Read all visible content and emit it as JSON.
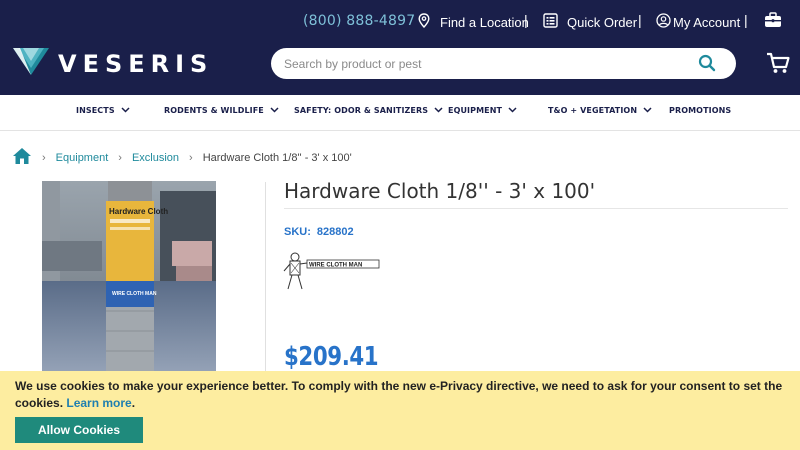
{
  "header": {
    "phone": "(800) 888-4897",
    "find_location": "Find a Location",
    "quick_order": "Quick Order",
    "my_account": "My Account",
    "logo_text": "VESERIS",
    "search_placeholder": "Search by product or pest"
  },
  "nav": {
    "items": [
      {
        "label": "INSECTS"
      },
      {
        "label": "RODENTS & WILDLIFE"
      },
      {
        "label": "SAFETY: ODOR & SANITIZERS"
      },
      {
        "label": "EQUIPMENT"
      },
      {
        "label": "T&O + VEGETATION"
      },
      {
        "label": "PROMOTIONS"
      }
    ]
  },
  "breadcrumb": {
    "items": [
      "Equipment",
      "Exclusion"
    ],
    "current": "Hardware Cloth 1/8'' - 3' x 100'"
  },
  "product": {
    "title": "Hardware Cloth 1/8'' - 3' x 100'",
    "sku_label": "SKU:",
    "sku_value": "828802",
    "brand_text": "WIRE CLOTH MAN",
    "price": "$209.41",
    "label_text_1": "Hardware Cloth",
    "label_text_2": "WIRE CLOTH MAN"
  },
  "cookie": {
    "text": "We use cookies to make your experience better. To comply with the new e-Privacy directive, we need to ask for your consent to set the cookies.",
    "link": "Learn more",
    "suffix": ".",
    "button": "Allow Cookies"
  },
  "colors": {
    "header_bg": "#1a1f4a",
    "accent_teal": "#1f8a9c",
    "price_blue": "#2873c9",
    "cookie_bg": "#fdeda0",
    "cookie_button": "#1f8a7c"
  }
}
